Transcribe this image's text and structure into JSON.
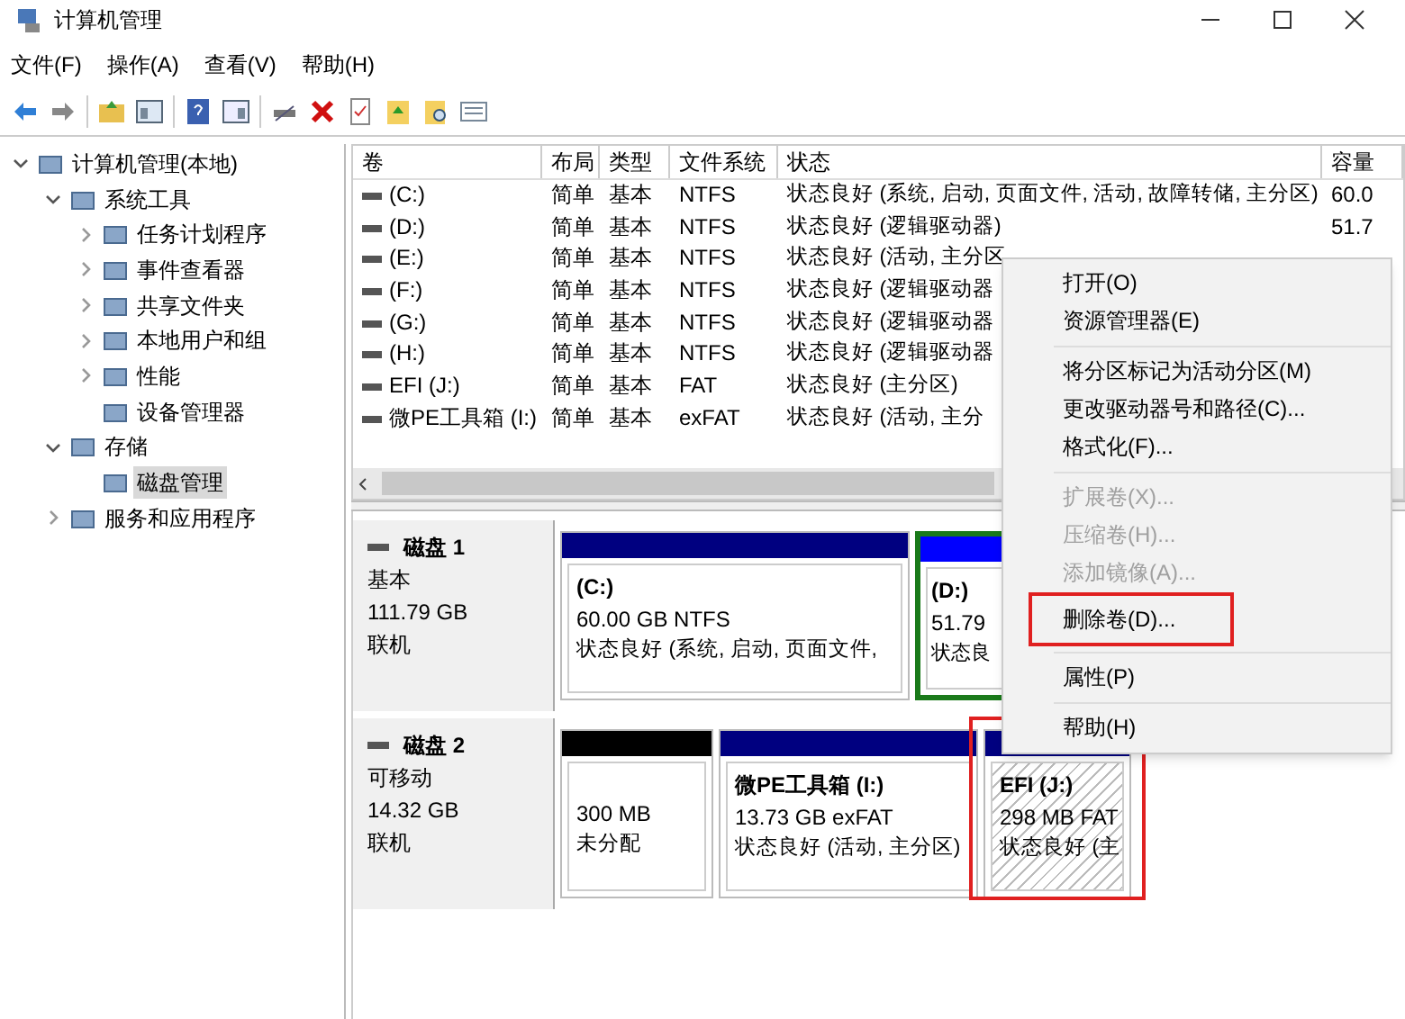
{
  "window": {
    "title": "计算机管理"
  },
  "menu_bar": [
    "文件(F)",
    "操作(A)",
    "查看(V)",
    "帮助(H)"
  ],
  "tree": [
    {
      "label": "计算机管理(本地)",
      "selected": false,
      "expanded": true,
      "children": [
        {
          "label": "系统工具",
          "selected": false,
          "expanded": true,
          "children": [
            {
              "label": "任务计划程序",
              "selected": false,
              "expandable": true
            },
            {
              "label": "事件查看器",
              "selected": false,
              "expandable": true
            },
            {
              "label": "共享文件夹",
              "selected": false,
              "expandable": true
            },
            {
              "label": "本地用户和组",
              "selected": false,
              "expandable": true
            },
            {
              "label": "性能",
              "selected": false,
              "expandable": true
            },
            {
              "label": "设备管理器",
              "selected": false,
              "expandable": false
            }
          ]
        },
        {
          "label": "存储",
          "selected": false,
          "expanded": true,
          "children": [
            {
              "label": "磁盘管理",
              "selected": true,
              "expandable": false
            }
          ]
        },
        {
          "label": "服务和应用程序",
          "selected": false,
          "expandable": true
        }
      ]
    }
  ],
  "table": {
    "columns": [
      "卷",
      "布局",
      "类型",
      "文件系统",
      "状态",
      "容量"
    ],
    "rows": [
      [
        "(C:)",
        "简单",
        "基本",
        "NTFS",
        "状态良好 (系统, 启动, 页面文件, 活动, 故障转储, 主分区)",
        "60.0"
      ],
      [
        "(D:)",
        "简单",
        "基本",
        "NTFS",
        "状态良好 (逻辑驱动器)",
        "51.7"
      ],
      [
        "(E:)",
        "简单",
        "基本",
        "NTFS",
        "状态良好 (活动, 主分区"
      ],
      [
        "(F:)",
        "简单",
        "基本",
        "NTFS",
        "状态良好 (逻辑驱动器"
      ],
      [
        "(G:)",
        "简单",
        "基本",
        "NTFS",
        "状态良好 (逻辑驱动器"
      ],
      [
        "(H:)",
        "简单",
        "基本",
        "NTFS",
        "状态良好 (逻辑驱动器"
      ],
      [
        "EFI (J:)",
        "简单",
        "基本",
        "FAT",
        "状态良好 (主分区)"
      ],
      [
        "微PE工具箱 (I:)",
        "简单",
        "基本",
        "exFAT",
        "状态良好 (活动, 主分"
      ]
    ]
  },
  "disks": [
    {
      "name": "磁盘 1",
      "type": "基本",
      "size": "111.79 GB",
      "status": "联机",
      "partitions": [
        {
          "label": "(C:)",
          "size": "60.00 GB NTFS",
          "status": "状态良好 (系统, 启动, 页面文件,",
          "color": "#000080",
          "selected": false,
          "annotated": false,
          "kind": "primary"
        },
        {
          "label": "(D:)",
          "size": "51.79",
          "status": "状态良",
          "color": "#0000ff",
          "selected": false,
          "annotated": false,
          "kind": "logical"
        }
      ]
    },
    {
      "name": "磁盘 2",
      "type": "可移动",
      "size": "14.32 GB",
      "status": "联机",
      "partitions": [
        {
          "size": "300 MB",
          "status": "未分配",
          "color": "#000000",
          "selected": false,
          "annotated": false,
          "kind": "unallocated"
        },
        {
          "label": "微PE工具箱  (I:)",
          "size": "13.73 GB exFAT",
          "status": "状态良好 (活动, 主分区)",
          "color": "#000080",
          "selected": false,
          "annotated": false,
          "kind": "primary"
        },
        {
          "label": "EFI  (J:)",
          "size": "298 MB FAT",
          "status": "状态良好 (主",
          "color": "#000080",
          "selected": true,
          "annotated": true,
          "kind": "primary"
        }
      ]
    }
  ],
  "context_menu": {
    "groups": [
      [
        {
          "label": "打开(O)",
          "disabled": false,
          "annotated": false
        },
        {
          "label": "资源管理器(E)",
          "disabled": false,
          "annotated": false
        }
      ],
      [
        {
          "label": "将分区标记为活动分区(M)",
          "disabled": false,
          "annotated": false
        },
        {
          "label": "更改驱动器号和路径(C)...",
          "disabled": false,
          "annotated": false
        },
        {
          "label": "格式化(F)...",
          "disabled": false,
          "annotated": false
        }
      ],
      [
        {
          "label": "扩展卷(X)...",
          "disabled": true,
          "annotated": false
        },
        {
          "label": "压缩卷(H)...",
          "disabled": true,
          "annotated": false
        },
        {
          "label": "添加镜像(A)...",
          "disabled": true,
          "annotated": false
        },
        {
          "label": "删除卷(D)...",
          "disabled": false,
          "annotated": true
        }
      ],
      [
        {
          "label": "属性(P)",
          "disabled": false,
          "annotated": false
        }
      ],
      [
        {
          "label": "帮助(H)",
          "disabled": false,
          "annotated": false
        }
      ]
    ]
  }
}
